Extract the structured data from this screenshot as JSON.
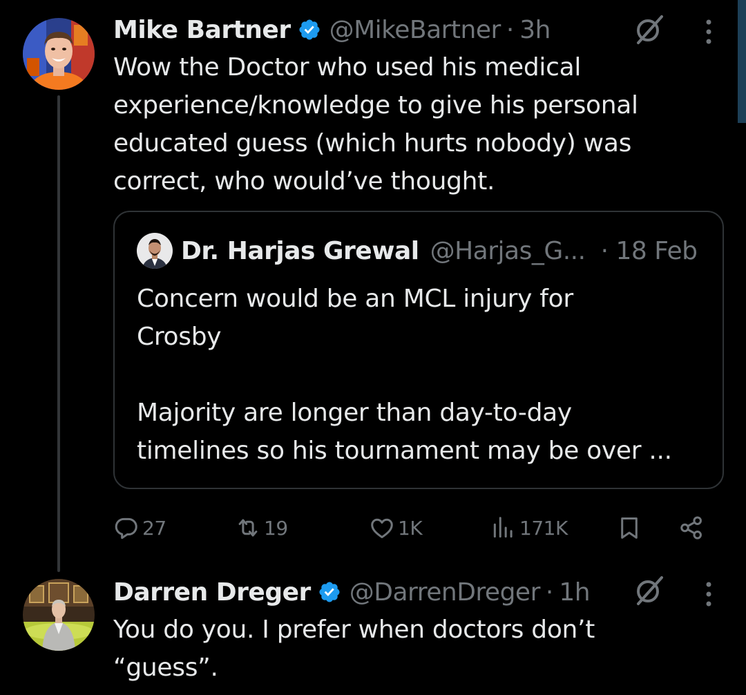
{
  "colors": {
    "background": "#000000",
    "text_primary": "#e7e9ea",
    "text_secondary": "#71767b",
    "verified_badge": "#1d9bf0",
    "border": "#2f3336"
  },
  "tweets": [
    {
      "author_name": "Mike Bartner",
      "verified": true,
      "handle": "@MikeBartner",
      "separator": "·",
      "time": "3h",
      "text": "Wow the Doctor who used his medical\nexperience/knowledge to give his personal\neducated guess (which hurts nobody) was\ncorrect, who would’ve thought.",
      "quote": {
        "author_name": "Dr. Harjas Grewal",
        "handle": "@Harjas_G...",
        "time": "· 18 Feb",
        "text": "Concern would be an MCL injury for\nCrosby\n\nMajority are longer than day-to-day\ntimelines so his tournament may be over ..."
      },
      "actions": {
        "replies": "27",
        "reposts": "19",
        "likes": "1K",
        "views": "171K"
      },
      "icons": [
        "grok-icon",
        "more-icon",
        "reply-icon",
        "repost-icon",
        "like-icon",
        "views-icon",
        "bookmark-icon",
        "share-icon"
      ]
    },
    {
      "author_name": "Darren Dreger",
      "verified": true,
      "handle": "@DarrenDreger",
      "separator": "·",
      "time": "1h",
      "text": "You do you. I prefer when doctors don’t\n“guess”."
    }
  ]
}
